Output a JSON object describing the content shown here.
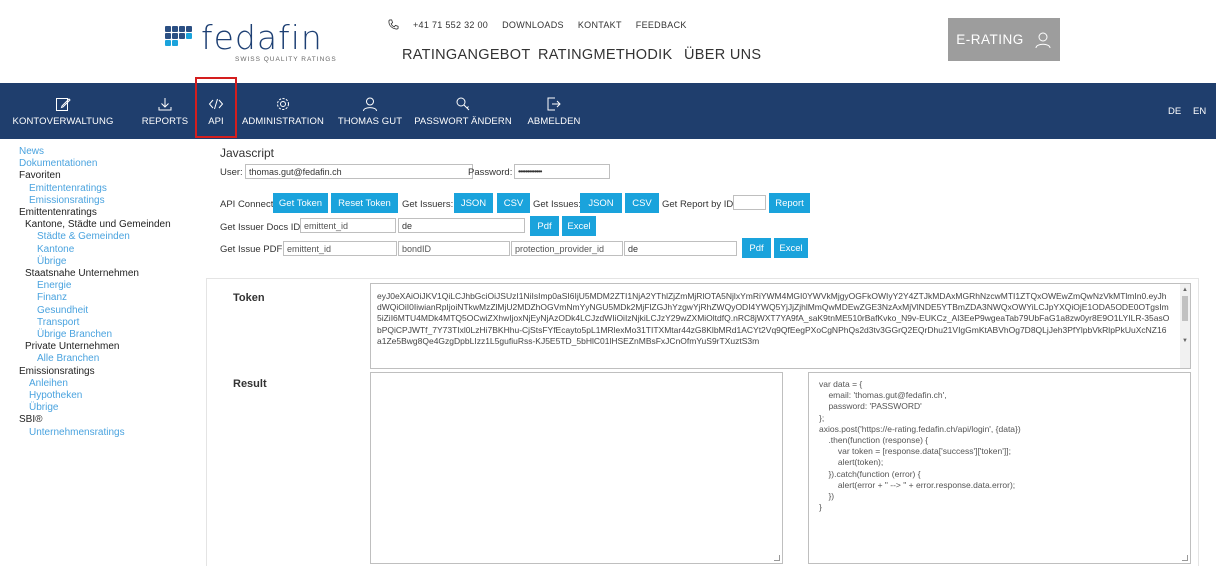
{
  "brand": {
    "name": "fedafin",
    "tagline": "SWISS QUALITY RATINGS",
    "accent": "#1aa3dc",
    "nav_bg": "#1f3e6d",
    "highlight": "#d41e1e"
  },
  "topbar": {
    "phone": "+41 71 552 32 00",
    "links": [
      "DOWNLOADS",
      "KONTAKT",
      "FEEDBACK"
    ]
  },
  "mainnav": [
    "RATINGANGEBOT",
    "RATINGMETHODIK",
    "ÜBER UNS"
  ],
  "erating": {
    "label": "E-RATING",
    "icon": "user-icon"
  },
  "bluenav": {
    "items": [
      {
        "label": "KONTOVERWALTUNG",
        "icon": "edit-icon"
      },
      {
        "label": "REPORTS",
        "icon": "download-icon"
      },
      {
        "label": "API",
        "icon": "code-icon"
      },
      {
        "label": "ADMINISTRATION",
        "icon": "gear-icon"
      },
      {
        "label": "THOMAS GUT",
        "icon": "user-icon"
      },
      {
        "label": "PASSWORT ÄNDERN",
        "icon": "key-icon"
      },
      {
        "label": "ABMELDEN",
        "icon": "logout-icon"
      }
    ],
    "languages": [
      "DE",
      "EN"
    ]
  },
  "sidebar": [
    {
      "label": "News",
      "type": "link"
    },
    {
      "label": "Dokumentationen",
      "type": "link"
    },
    {
      "label": "Favoriten",
      "type": "heading"
    },
    {
      "label": "Emittentenratings",
      "type": "link"
    },
    {
      "label": "Emissionsratings",
      "type": "link"
    },
    {
      "label": "Emittentenratings",
      "type": "heading"
    },
    {
      "label": "Kantone, Städte und Gemeinden",
      "type": "heading"
    },
    {
      "label": "Städte & Gemeinden",
      "type": "link"
    },
    {
      "label": "Kantone",
      "type": "link"
    },
    {
      "label": "Übrige",
      "type": "link"
    },
    {
      "label": "Staatsnahe Unternehmen",
      "type": "heading"
    },
    {
      "label": "Energie",
      "type": "link"
    },
    {
      "label": "Finanz",
      "type": "link"
    },
    {
      "label": "Gesundheit",
      "type": "link"
    },
    {
      "label": "Transport",
      "type": "link"
    },
    {
      "label": "Übrige Branchen",
      "type": "link"
    },
    {
      "label": "Private Unternehmen",
      "type": "heading"
    },
    {
      "label": "Alle Branchen",
      "type": "link"
    },
    {
      "label": "Emissionsratings",
      "type": "heading"
    },
    {
      "label": "Anleihen",
      "type": "link"
    },
    {
      "label": "Hypotheken",
      "type": "link"
    },
    {
      "label": "Übrige",
      "type": "link"
    },
    {
      "label": "SBI®",
      "type": "heading"
    },
    {
      "label": "Unternehmensratings",
      "type": "link"
    }
  ],
  "api": {
    "title": "Javascript",
    "user_label": "User:",
    "user_value": "thomas.gut@fedafin.ch",
    "password_label": "Password:",
    "password_value": "•••••••••••••",
    "connect_label": "API Connect",
    "get_token": "Get Token",
    "reset_token": "Reset Token",
    "get_issuers_label": "Get Issuers:",
    "json": "JSON",
    "csv": "CSV",
    "get_issues_label": "Get Issues:",
    "get_report_label": "Get Report by ID:",
    "report_id_value": "",
    "report_btn": "Report",
    "issuer_docs_label": "Get Issuer Docs ID:",
    "issuer_docs_placeholder": "emittent_id",
    "issuer_docs_lang": "de",
    "pdf": "Pdf",
    "excel": "Excel",
    "issue_pdf_label": "Get Issue PDF:",
    "issue_pdf_emittent": "emittent_id",
    "issue_pdf_bond": "bondID",
    "issue_pdf_provider": "protection_provider_id",
    "issue_pdf_lang": "de"
  },
  "token_section": {
    "label": "Token",
    "value": "eyJ0eXAiOiJKV1QiLCJhbGciOiJSUzI1NiIsImp0aSI6IjU5MDM2ZTI1NjA2YThlZjZmMjRlOTA5NjlxYmRiYWM4MGI0YWVkMjgyOGFkOWIyY2Y4ZTJkMDAxMGRhNzcwMTI1ZTQxOWEwZmQwNzVkMTlmIn0.eyJhdWQiOiI0IiwianRpIjoiNTkwMzZlMjU2MDZhOGVmNmYyNGU5MDk2MjFlZGJhYzgwYjRhZWQyODI4YWQ5YjJjZjhlMmQwMDEwZGE3NzAxMjVlNDE5YTBmZDA3NWQxOWYiLCJpYXQiOjE1ODA5ODE0OTgsIm5iZiI6MTU4MDk4MTQ5OCwiZXhwIjoxNjEyNjAzODk4LCJzdWIiOiIzNjkiLCJzY29wZXMiOltdfQ.nRC8jWXT7YA9fA_saK9tnME510rBafKvko_N9v-EUKCz_Al3EeP9wgeaTab79UbFaG1a8zw0yr8E9O1LYILR-35asObPQiCPJWTf_7Y73TIxl0LzHi7BKHhu-CjStsFYfEcayto5pL1MRlexMo31TITXMtar44zG8KlbMRd1ACYt2Vq9QfEegPXoCgNPhQs2d3tv3GGrQ2EQrDhu21VIgGmKtABVhOg7D8QLjJeh3PfYlpbVkRlpPkUuXcNZ16a1Ze5Bwg8Qe4GzgDpbLIzz1L5gufiuRss-KJ5E5TD_5bHlC01lHSEZnMBsFxJCnOfmYuS9rTXuztS3m"
  },
  "result_section": {
    "label": "Result",
    "output": "",
    "code": "var data = {\n    email: 'thomas.gut@fedafin.ch',\n    password: 'PASSWORD'\n};\naxios.post('https://e-rating.fedafin.ch/api/login', {data})\n    .then(function (response) {\n        var token = [response.data['success']['token']];\n        alert(token);\n    }).catch(function (error) {\n        alert(error + \" --> \" + error.response.data.error);\n    })\n}"
  }
}
